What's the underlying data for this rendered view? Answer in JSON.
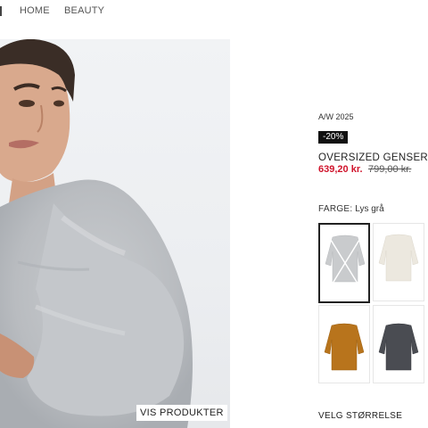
{
  "nav": {
    "items": [
      "HOME",
      "BEAUTY"
    ]
  },
  "hero": {
    "button_label": "VIS PRODUKTER"
  },
  "product": {
    "season": "A/W 2025",
    "discount_badge": "-20%",
    "title": "OVERSIZED GENSER I M",
    "price_sale": "639,20 kr.",
    "price_original": "799,00 kr.",
    "color_label": "FARGE:",
    "color_value": "Lys grå",
    "swatches": [
      {
        "name": "light-grey",
        "color": "#c9cbcd",
        "selected": true,
        "unavailable": true
      },
      {
        "name": "cream",
        "color": "#ece8df",
        "selected": false,
        "unavailable": false
      },
      {
        "name": "mustard",
        "color": "#b8741c",
        "selected": false,
        "unavailable": false
      },
      {
        "name": "charcoal",
        "color": "#4a4c52",
        "selected": false,
        "unavailable": false
      }
    ],
    "size_label": "VELG STØRRELSE"
  }
}
